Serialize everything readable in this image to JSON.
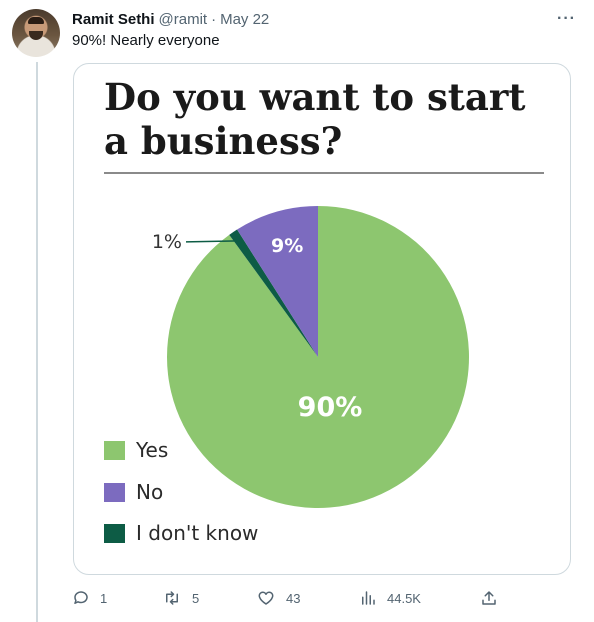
{
  "tweet": {
    "author_name": "Ramit Sethi",
    "author_handle": "@ramit",
    "separator": "·",
    "date": "May 22",
    "text": "90%! Nearly everyone",
    "more_label": "···"
  },
  "media": {
    "title_line1": "Do you want to start",
    "title_line2": "a business?"
  },
  "chart_data": {
    "type": "pie",
    "title": "Do you want to start a business?",
    "categories": [
      "Yes",
      "No",
      "I don't know"
    ],
    "values": [
      90,
      9,
      1
    ],
    "labels": [
      "90%",
      "9%",
      "1%"
    ],
    "colors": [
      "#8dc66f",
      "#7c6bbf",
      "#0d5c45"
    ],
    "legend_position": "bottom-left"
  },
  "actions": {
    "reply_count": "1",
    "retweet_count": "5",
    "like_count": "43",
    "views_count": "44.5K"
  },
  "icons": [
    "reply-icon",
    "retweet-icon",
    "like-icon",
    "views-icon",
    "share-icon",
    "more-icon"
  ]
}
